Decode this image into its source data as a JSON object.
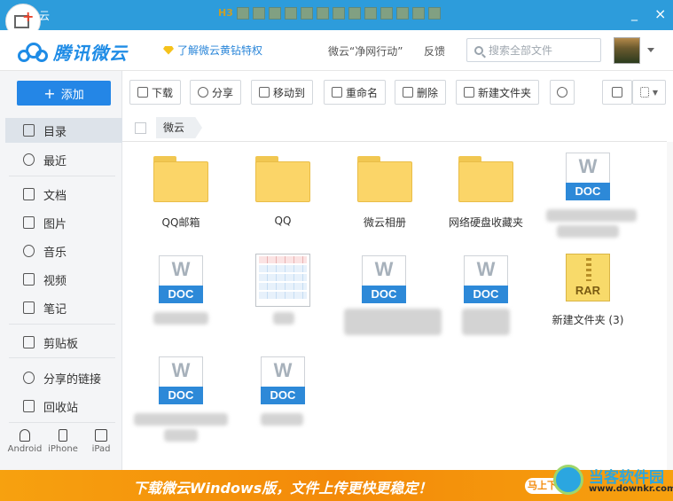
{
  "titlebar": {
    "app_name_fragment": "云",
    "minimize": "_",
    "close": "×",
    "toolbar_h3": "H3"
  },
  "header": {
    "logo_text": "腾讯微云",
    "vip_link": "了解微云黄钻特权",
    "campaign_link": "微云“净网行动”",
    "feedback_link": "反馈",
    "search_placeholder": "搜索全部文件"
  },
  "sidebar": {
    "add_label": "添加",
    "add_icon": "+",
    "items": [
      {
        "label": "目录",
        "icon": "catalog-icon",
        "active": true
      },
      {
        "label": "最近",
        "icon": "clock-icon"
      },
      {
        "label": "文档",
        "icon": "document-icon"
      },
      {
        "label": "图片",
        "icon": "image-icon"
      },
      {
        "label": "音乐",
        "icon": "music-icon"
      },
      {
        "label": "视频",
        "icon": "video-icon"
      },
      {
        "label": "笔记",
        "icon": "note-icon"
      },
      {
        "label": "剪贴板",
        "icon": "clipboard-icon"
      },
      {
        "label": "分享的链接",
        "icon": "link-icon"
      },
      {
        "label": "回收站",
        "icon": "trash-icon"
      }
    ],
    "devices": [
      {
        "label": "Android",
        "icon": "android-icon"
      },
      {
        "label": "iPhone",
        "icon": "iphone-icon"
      },
      {
        "label": "iPad",
        "icon": "ipad-icon"
      }
    ]
  },
  "toolbar": {
    "buttons": [
      {
        "label": "下载",
        "icon": "download-icon"
      },
      {
        "label": "分享",
        "icon": "share-icon"
      },
      {
        "label": "移动到",
        "icon": "move-icon"
      },
      {
        "label": "重命名",
        "icon": "rename-icon"
      },
      {
        "label": "删除",
        "icon": "delete-icon"
      },
      {
        "label": "新建文件夹",
        "icon": "new-folder-icon"
      }
    ],
    "refresh_icon": "refresh-icon",
    "view_single_icon": "panel-view-icon",
    "view_grid_icon": "grid-view-icon"
  },
  "breadcrumb": {
    "root": "微云"
  },
  "files": [
    {
      "name": "QQ邮箱",
      "type": "folder"
    },
    {
      "name": "QQ",
      "type": "folder"
    },
    {
      "name": "微云相册",
      "type": "folder"
    },
    {
      "name": "网络硬盘收藏夹",
      "type": "folder"
    },
    {
      "name": "",
      "type": "doc",
      "badge": "DOC",
      "letter": "W"
    },
    {
      "name": "",
      "type": "doc",
      "badge": "DOC",
      "letter": "W"
    },
    {
      "name": "",
      "type": "sheet"
    },
    {
      "name": "",
      "type": "doc",
      "badge": "DOC",
      "letter": "W"
    },
    {
      "name": "",
      "type": "doc",
      "badge": "DOC",
      "letter": "W"
    },
    {
      "name": "新建文件夹 (3)",
      "type": "rar",
      "badge": "RAR"
    },
    {
      "name": "",
      "type": "doc",
      "badge": "DOC",
      "letter": "W"
    },
    {
      "name": "",
      "type": "doc",
      "badge": "DOC",
      "letter": "W"
    }
  ],
  "banner": {
    "text": "下载微云Windows版，文件上传更快更稳定！",
    "button": "马上下载"
  },
  "watermark": {
    "title": "当客软件园",
    "url": "www.downkr.com"
  },
  "colors": {
    "titlebar": "#2d9cdb",
    "accent": "#2486e6",
    "banner": "#f38a09",
    "folder": "#fbd568"
  }
}
